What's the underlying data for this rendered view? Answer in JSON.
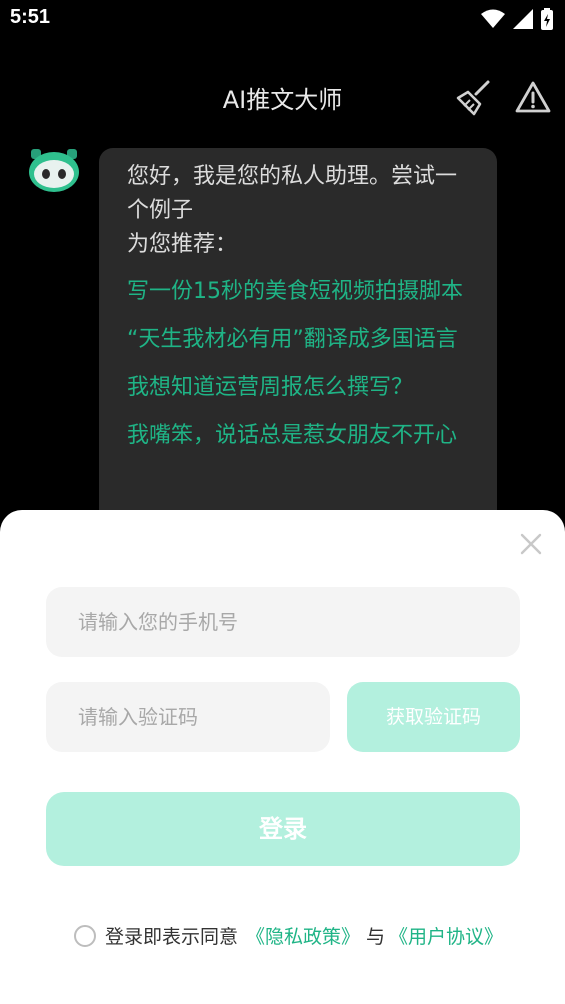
{
  "status_bar": {
    "time": "5:51"
  },
  "header": {
    "title": "AI推文大师",
    "clear_icon": "broom-icon",
    "report_icon": "warning-icon"
  },
  "chat": {
    "avatar_icon": "robot-avatar-icon",
    "greeting_line1": "您好，我是您的私人助理。尝试一个例子",
    "greeting_line2": "为您推荐：",
    "suggestions": [
      "写一份15秒的美食短视频拍摄脚本",
      "“天生我材必有用”翻译成多国语言",
      "我想知道运营周报怎么撰写？",
      "我嘴笨，说话总是惹女朋友不开心"
    ]
  },
  "login_sheet": {
    "phone_placeholder": "请输入您的手机号",
    "code_placeholder": "请输入验证码",
    "get_code_label": "获取验证码",
    "login_label": "登录",
    "agreement_text": "登录即表示同意",
    "privacy_link": "《隐私政策》",
    "and_text": "与",
    "user_agreement_link": "《用户协议》",
    "close_icon": "close-icon"
  },
  "colors": {
    "accent": "#1fb486",
    "button_disabled": "#b3f0de",
    "bubble_bg": "#2a2a2a"
  }
}
